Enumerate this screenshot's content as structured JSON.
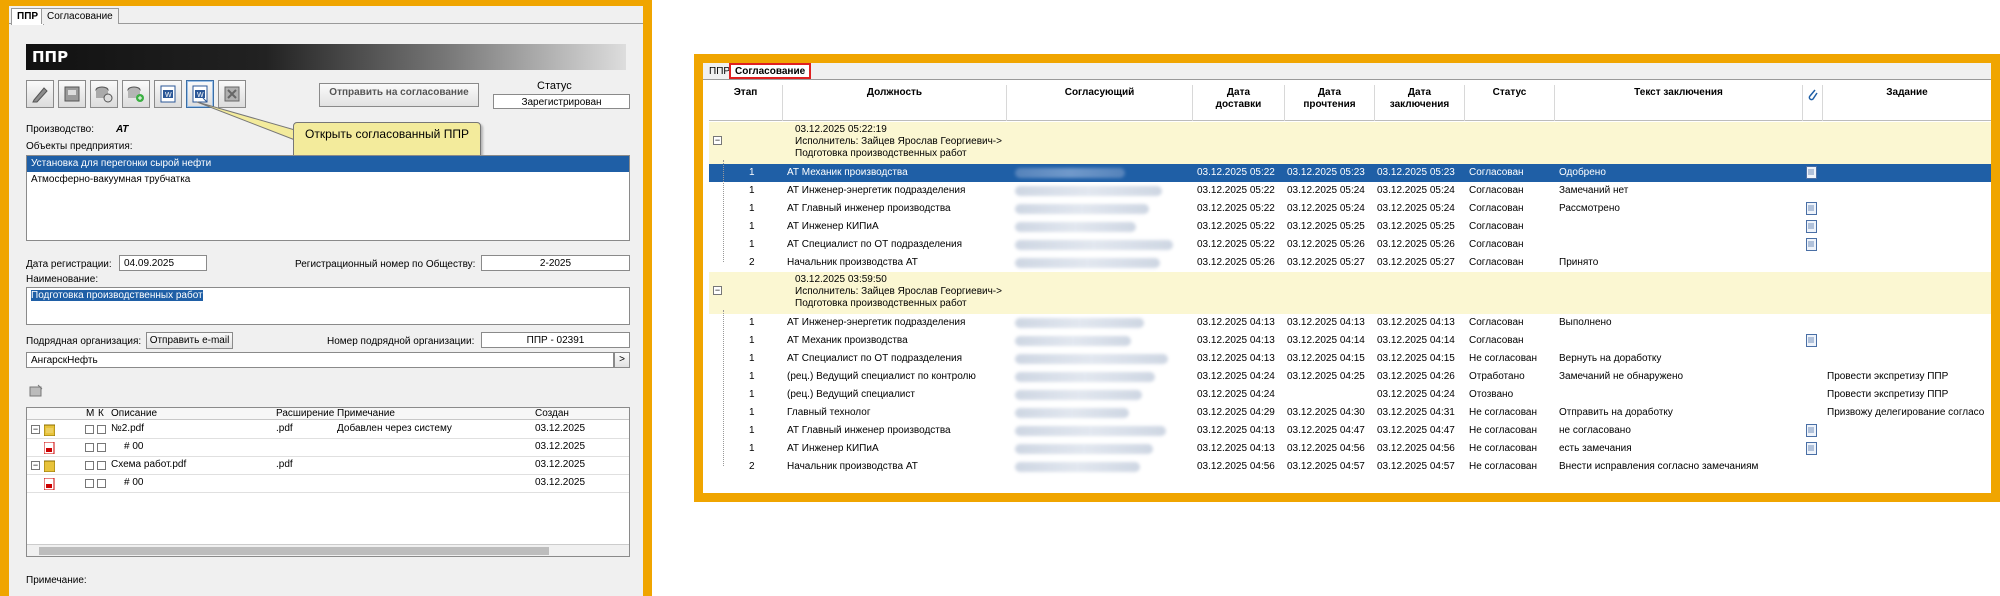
{
  "left": {
    "tabs": [
      "ППР",
      "Согласование"
    ],
    "header_title": "ППР",
    "toolbar_icons": [
      "edit-icon",
      "print-icon",
      "copy-settings-icon",
      "database-add-icon",
      "word-doc-icon",
      "word-open-icon",
      "delete-icon"
    ],
    "send_button": "Отправить на согласование",
    "status_label": "Статус",
    "status_value": "Зарегистрирован",
    "callout": "Открыть согласованный ППР",
    "production_label": "Производство:",
    "production_value": "АТ",
    "objects_label": "Объекты предприятия:",
    "objects": [
      "Установка для перегонки сырой нефти",
      "Атмосферно-вакуумная трубчатка"
    ],
    "reg_date_label": "Дата регистрации:",
    "reg_date_value": "04.09.2025",
    "reg_number_label": "Регистрационный номер по Обществу:",
    "reg_number_value": "2-2025",
    "name_label": "Наименование:",
    "name_value": "Подготовка производственных работ",
    "contractor_label": "Подрядная организация:",
    "email_button": "Отправить e-mail",
    "contractor_number_label": "Номер подрядной организации:",
    "contractor_number_value": "ППР - 02391",
    "contractor_value": "АнгарскНефть",
    "browse_button": ">",
    "files_header": {
      "m": "М",
      "k": "К",
      "desc": "Описание",
      "ext": "Расширение",
      "note": "Примечание",
      "created": "Создан"
    },
    "files": [
      {
        "desc": "№2.pdf",
        "ext": ".pdf",
        "note": "Добавлен через систему",
        "created": "03.12.2025",
        "sub": "# 00",
        "sub_created": "03.12.2025"
      },
      {
        "desc": "Схема работ.pdf",
        "ext": ".pdf",
        "note": "",
        "created": "03.12.2025",
        "sub": "# 00",
        "sub_created": "03.12.2025"
      }
    ],
    "note_label": "Примечание:"
  },
  "right": {
    "tabs": [
      "ППР",
      "Согласование"
    ],
    "columns": [
      "Этап",
      "Должность",
      "Согласующий",
      "Дата доставки",
      "Дата прочтения",
      "Дата заключения",
      "Статус",
      "Текст заключения",
      "Задание"
    ],
    "groups": [
      {
        "date": "03.12.2025 05:22:19",
        "executor": "Исполнитель: Зайцев Ярослав Георгиевич->",
        "title": "Подготовка производственных работ",
        "rows": [
          {
            "stage": "1",
            "position": "АТ Механик производства",
            "delivery": "03.12.2025 05:22",
            "read": "03.12.2025 05:23",
            "concl": "03.12.2025 05:23",
            "status": "Согласован",
            "text": "Одобрено",
            "task": "",
            "attach": true,
            "selected": true
          },
          {
            "stage": "1",
            "position": "АТ Инженер-энергетик подразделения",
            "delivery": "03.12.2025 05:22",
            "read": "03.12.2025 05:24",
            "concl": "03.12.2025 05:24",
            "status": "Согласован",
            "text": "Замечаний нет",
            "task": "",
            "attach": false
          },
          {
            "stage": "1",
            "position": "АТ Главный инженер производства",
            "delivery": "03.12.2025 05:22",
            "read": "03.12.2025 05:24",
            "concl": "03.12.2025 05:24",
            "status": "Согласован",
            "text": "Рассмотрено",
            "task": "",
            "attach": true
          },
          {
            "stage": "1",
            "position": "АТ Инженер КИПиА",
            "delivery": "03.12.2025 05:22",
            "read": "03.12.2025 05:25",
            "concl": "03.12.2025 05:25",
            "status": "Согласован",
            "text": "",
            "task": "",
            "attach": true
          },
          {
            "stage": "1",
            "position": "АТ Специалист по ОТ подразделения",
            "delivery": "03.12.2025 05:22",
            "read": "03.12.2025 05:26",
            "concl": "03.12.2025 05:26",
            "status": "Согласован",
            "text": "",
            "task": "",
            "attach": true
          },
          {
            "stage": "2",
            "position": "Начальник производства АТ",
            "delivery": "03.12.2025 05:26",
            "read": "03.12.2025 05:27",
            "concl": "03.12.2025 05:27",
            "status": "Согласован",
            "text": "Принято",
            "task": "",
            "attach": false
          }
        ]
      },
      {
        "date": "03.12.2025 03:59:50",
        "executor": "Исполнитель: Зайцев Ярослав Георгиевич->",
        "title": "Подготовка производственных работ",
        "rows": [
          {
            "stage": "1",
            "position": "АТ Инженер-энергетик подразделения",
            "delivery": "03.12.2025 04:13",
            "read": "03.12.2025 04:13",
            "concl": "03.12.2025 04:13",
            "status": "Согласован",
            "text": "Выполнено",
            "task": "",
            "attach": false
          },
          {
            "stage": "1",
            "position": "АТ Механик производства",
            "delivery": "03.12.2025 04:13",
            "read": "03.12.2025 04:14",
            "concl": "03.12.2025 04:14",
            "status": "Согласован",
            "text": "",
            "task": "",
            "attach": true
          },
          {
            "stage": "1",
            "position": "АТ Специалист по ОТ подразделения",
            "delivery": "03.12.2025 04:13",
            "read": "03.12.2025 04:15",
            "concl": "03.12.2025 04:15",
            "status": "Не согласован",
            "text": "Вернуть на доработку",
            "task": "",
            "attach": false
          },
          {
            "stage": "1",
            "position": "(рец.) Ведущий специалист по контролю",
            "delivery": "03.12.2025 04:24",
            "read": "03.12.2025 04:25",
            "concl": "03.12.2025 04:26",
            "status": "Отработано",
            "text": "Замечаний не обнаружено",
            "task": "Провести экспретизу ППР",
            "attach": false
          },
          {
            "stage": "1",
            "position": "(рец.) Ведущий специалист",
            "delivery": "03.12.2025 04:24",
            "read": "",
            "concl": "03.12.2025 04:24",
            "status": "Отозвано",
            "text": "",
            "task": "Провести экспретизу ППР",
            "attach": false
          },
          {
            "stage": "1",
            "position": "Главный технолог",
            "delivery": "03.12.2025 04:29",
            "read": "03.12.2025 04:30",
            "concl": "03.12.2025 04:31",
            "status": "Не согласован",
            "text": "Отправить на доработку",
            "task": "Призвожу делегирование согласо",
            "attach": false
          },
          {
            "stage": "1",
            "position": "АТ Главный инженер производства",
            "delivery": "03.12.2025 04:13",
            "read": "03.12.2025 04:47",
            "concl": "03.12.2025 04:47",
            "status": "Не согласован",
            "text": "не согласовано",
            "task": "",
            "attach": true
          },
          {
            "stage": "1",
            "position": "АТ Инженер КИПиА",
            "delivery": "03.12.2025 04:13",
            "read": "03.12.2025 04:56",
            "concl": "03.12.2025 04:56",
            "status": "Не согласован",
            "text": "есть замечания",
            "task": "",
            "attach": true
          },
          {
            "stage": "2",
            "position": "Начальник производства АТ",
            "delivery": "03.12.2025 04:56",
            "read": "03.12.2025 04:57",
            "concl": "03.12.2025 04:57",
            "status": "Не согласован",
            "text": "Внести исправления согласно замечаниям",
            "task": "",
            "attach": false
          }
        ]
      }
    ]
  }
}
